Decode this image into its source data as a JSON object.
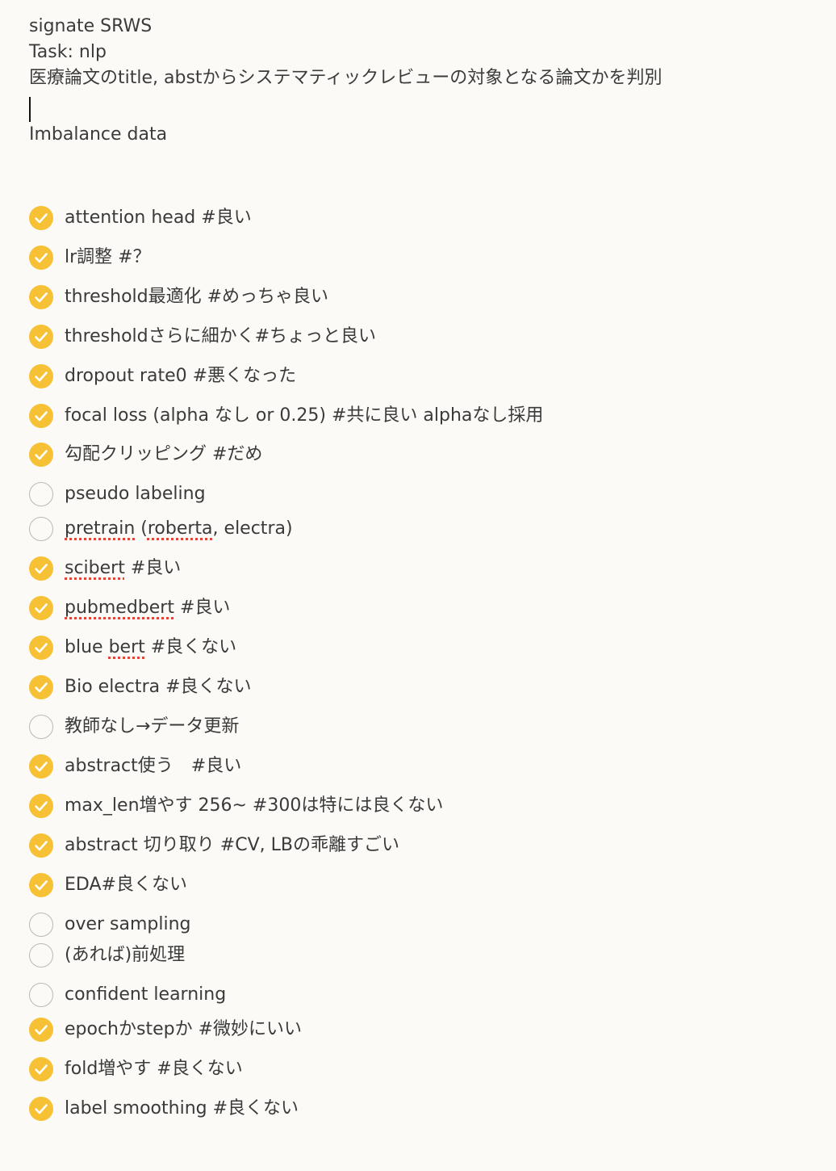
{
  "note": {
    "lines": [
      "signate SRWS",
      "Task: nlp",
      "医療論文のtitle, abstからシステマティックレビューの対象となる論文かを判別",
      "",
      "Imbalance data"
    ],
    "checklist": [
      {
        "text": "attention head #良い",
        "checked": true
      },
      {
        "text": "lr調整 #？",
        "checked": true
      },
      {
        "text": "threshold最適化 #めっちゃ良い",
        "checked": true
      },
      {
        "text": "thresholdさらに細かく#ちょっと良い",
        "checked": true
      },
      {
        "text": "dropout rate0 #悪くなった",
        "checked": true
      },
      {
        "text": "focal loss (alpha なし or 0.25) #共に良い alphaなし採用",
        "checked": true
      },
      {
        "text": "勾配クリッピング #だめ",
        "checked": true
      },
      {
        "text": "pseudo labeling",
        "checked": false
      },
      {
        "text": "pretrain (roberta, electra)",
        "checked": false
      },
      {
        "text": "scibert #良い",
        "checked": true
      },
      {
        "text": "pubmedbert #良い",
        "checked": true
      },
      {
        "text": "blue bert #良くない",
        "checked": true
      },
      {
        "text": "Bio electra #良くない",
        "checked": true
      },
      {
        "text": "教師なし→データ更新",
        "checked": false
      },
      {
        "text": "abstract使う　#良い",
        "checked": true
      },
      {
        "text": "max_len増やす 256~ #300は特には良くない",
        "checked": true
      },
      {
        "text": "abstract  切り取り #CV, LBの乖離すごい",
        "checked": true
      },
      {
        "text": "EDA#良くない",
        "checked": true
      },
      {
        "text": "over sampling",
        "checked": false
      },
      {
        "text": "(あれば)前処理",
        "checked": false
      },
      {
        "text": "confident learning",
        "checked": false
      },
      {
        "text": "epochかstepか #微妙にいい",
        "checked": true
      },
      {
        "text": "fold増やす #良くない",
        "checked": true
      },
      {
        "text": "label smoothing #良くない",
        "checked": true
      }
    ]
  },
  "colors": {
    "checked_fill": "#f6c135",
    "unchecked_border": "#b9b9b9",
    "background": "#fbfaf7",
    "spellcheck_underline": "#e0473c"
  },
  "icons": {
    "checked": "checkmark-circle-icon",
    "unchecked": "empty-circle-icon"
  }
}
